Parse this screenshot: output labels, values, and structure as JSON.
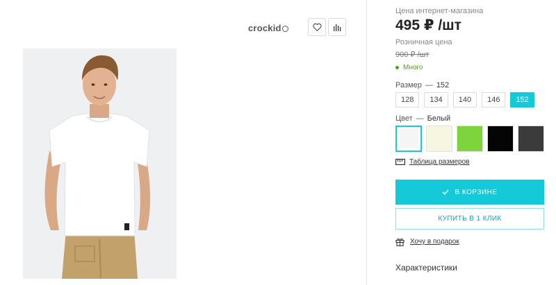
{
  "product": {
    "brand": "crockid",
    "online_price_label": "Цена интернет-магазина",
    "price": "495 ₽ /шт",
    "retail_price_label": "Розничная цена",
    "retail_price": "900 ₽ /шт",
    "stock": "Много"
  },
  "size": {
    "label": "Размер",
    "selected": "152",
    "options": [
      "128",
      "134",
      "140",
      "146",
      "152"
    ]
  },
  "color": {
    "label": "Цвет",
    "selected": "Белый",
    "swatches": [
      "#f5f5f5",
      "#f7f6e0",
      "#7ed43c",
      "#050505",
      "#3b3b3b"
    ]
  },
  "links": {
    "size_table": "Таблица размеров",
    "gift": "Хочу в подарок"
  },
  "buttons": {
    "cart": "В КОРЗИНЕ",
    "one_click": "КУПИТЬ В 1 КЛИК"
  },
  "characteristics": {
    "title": "Характеристики"
  },
  "colors": {
    "accent": "#14cad9",
    "in_stock": "#4aa21d"
  },
  "icons": [
    "heart-icon",
    "compare-chart-icon",
    "ruler-icon",
    "check-icon",
    "gift-icon"
  ]
}
